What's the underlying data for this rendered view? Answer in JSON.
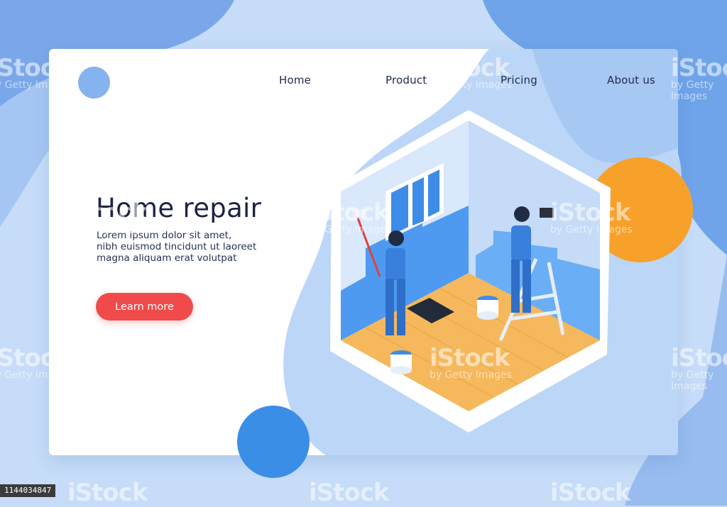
{
  "nav": {
    "home": "Home",
    "product": "Product",
    "pricing": "Pricing",
    "about": "About us"
  },
  "hero": {
    "title": "Home repair",
    "text_line1": "Lorem ipsum dolor sit amet,",
    "text_line2": "nibh euismod tincidunt ut laoreet",
    "text_line3": "magna aliquam erat volutpat",
    "cta_label": "Learn more"
  },
  "watermark": {
    "brand": "iStock",
    "credit": "by Getty Images"
  },
  "image_id": "1144034847",
  "icons": [
    "logo-circle-icon",
    "isometric-room-illustration"
  ],
  "colors": {
    "background": "#c6dcf8",
    "card": "#ffffff",
    "cta": "#f04a4a",
    "orange": "#f7a12b",
    "blue_circle": "#3b8ee6",
    "logo_circle": "#85b3ef",
    "text_dark": "#1c2443"
  }
}
